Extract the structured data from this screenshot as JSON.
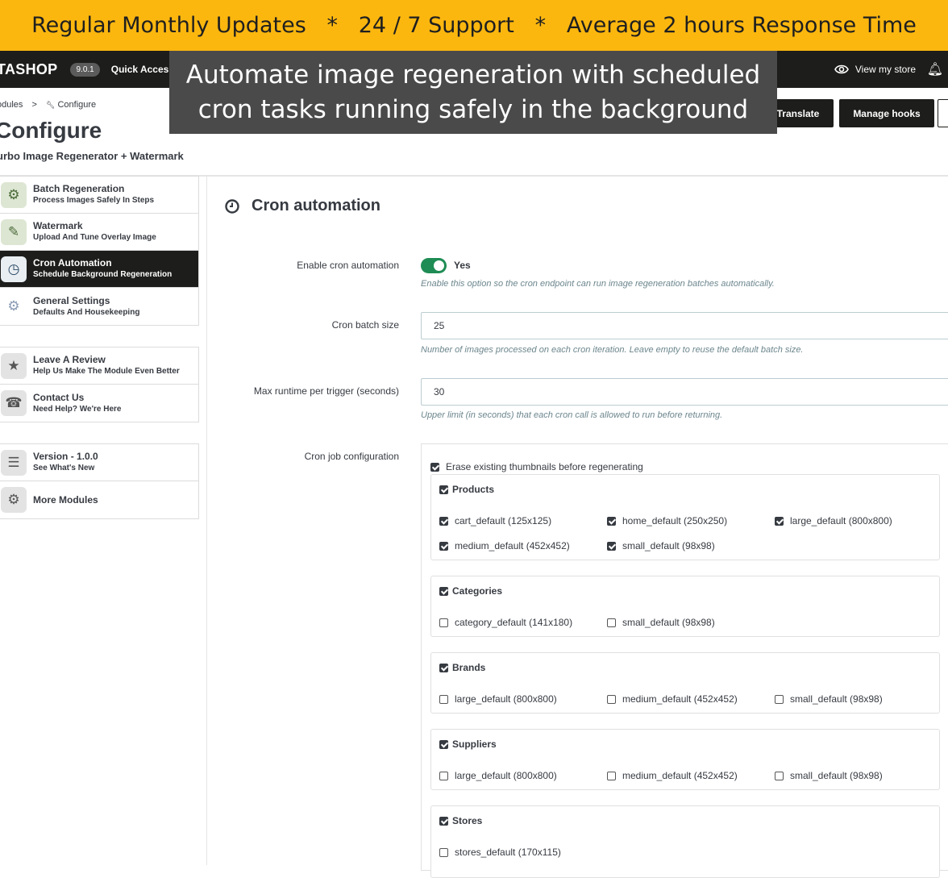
{
  "promo_banner": "Regular Monthly Updates   *   24 / 7 Support   *   Average 2 hours Response Time",
  "topbar": {
    "logo": "TASHOP",
    "version": "9.0.1",
    "quick_access": "Quick Acces",
    "view_store": "View my store"
  },
  "overlay_caption": {
    "line1": "Automate image regeneration with scheduled",
    "line2": "cron tasks running safely in the background"
  },
  "header": {
    "breadcrumb_modules": "odules",
    "breadcrumb_sep": ">",
    "breadcrumb_configure": "Configure",
    "title": "Configure",
    "subtitle": "urbo Image Regenerator + Watermark",
    "translate_button": "Translate",
    "manage_hooks_button": "Manage hooks"
  },
  "sidebar": {
    "group1": [
      {
        "title": "Batch Regeneration",
        "subtitle": "Process Images Safely In Steps",
        "icon": "images-gear-icon",
        "active": false
      },
      {
        "title": "Watermark",
        "subtitle": "Upload And Tune Overlay Image",
        "icon": "watermark-icon",
        "active": false
      },
      {
        "title": "Cron Automation",
        "subtitle": "Schedule Background Regeneration",
        "icon": "clock-gear-icon",
        "active": true
      },
      {
        "title": "General Settings",
        "subtitle": "Defaults And Housekeeping",
        "icon": "gear-icon",
        "active": false
      }
    ],
    "group2": [
      {
        "title": "Leave A Review",
        "subtitle": "Help Us Make The Module Even Better",
        "icon": "review-icon"
      },
      {
        "title": "Contact Us",
        "subtitle": "Need Help? We're Here",
        "icon": "support-icon"
      }
    ],
    "group3": [
      {
        "title": "Version - 1.0.0",
        "subtitle": "See What's New",
        "icon": "version-icon"
      },
      {
        "title": "More Modules",
        "subtitle": "",
        "icon": "modules-icon"
      }
    ]
  },
  "section": {
    "title": "Cron automation",
    "enable_label": "Enable cron automation",
    "enable_value": "Yes",
    "enable_help": "Enable this option so the cron endpoint can run image regeneration batches automatically.",
    "batch_label": "Cron batch size",
    "batch_value": "25",
    "batch_help": "Number of images processed on each cron iteration. Leave empty to reuse the default batch size.",
    "runtime_label": "Max runtime per trigger (seconds)",
    "runtime_value": "30",
    "runtime_help": "Upper limit (in seconds) that each cron call is allowed to run before returning.",
    "cron_label": "Cron job configuration",
    "erase_label": "Erase existing thumbnails before regenerating"
  },
  "groups": {
    "products": {
      "title": "Products",
      "items": [
        "cart_default (125x125)",
        "home_default (250x250)",
        "large_default (800x800)",
        "medium_default (452x452)",
        "small_default (98x98)"
      ]
    },
    "categories": {
      "title": "Categories",
      "items": [
        "category_default (141x180)",
        "small_default (98x98)"
      ]
    },
    "brands": {
      "title": "Brands",
      "items": [
        "large_default (800x800)",
        "medium_default (452x452)",
        "small_default (98x98)"
      ]
    },
    "suppliers": {
      "title": "Suppliers",
      "items": [
        "large_default (800x800)",
        "medium_default (452x452)",
        "small_default (98x98)"
      ]
    },
    "stores": {
      "title": "Stores",
      "items": [
        "stores_default (170x115)"
      ]
    }
  }
}
